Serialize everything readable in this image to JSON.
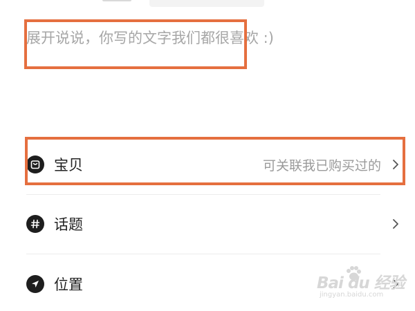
{
  "composer": {
    "placeholder": "展开说说，你写的文字我们都很喜欢 :)"
  },
  "options": [
    {
      "icon": "bag-icon",
      "label": "宝贝",
      "hint": "可关联我已购买过的"
    },
    {
      "icon": "hashtag-icon",
      "label": "话题",
      "hint": ""
    },
    {
      "icon": "location-arrow-icon",
      "label": "位置",
      "hint": ""
    }
  ],
  "highlight_color": "#e56f3f",
  "watermark": {
    "logo": "Bai du 经验",
    "sub": "jingyan.baidu.com"
  }
}
